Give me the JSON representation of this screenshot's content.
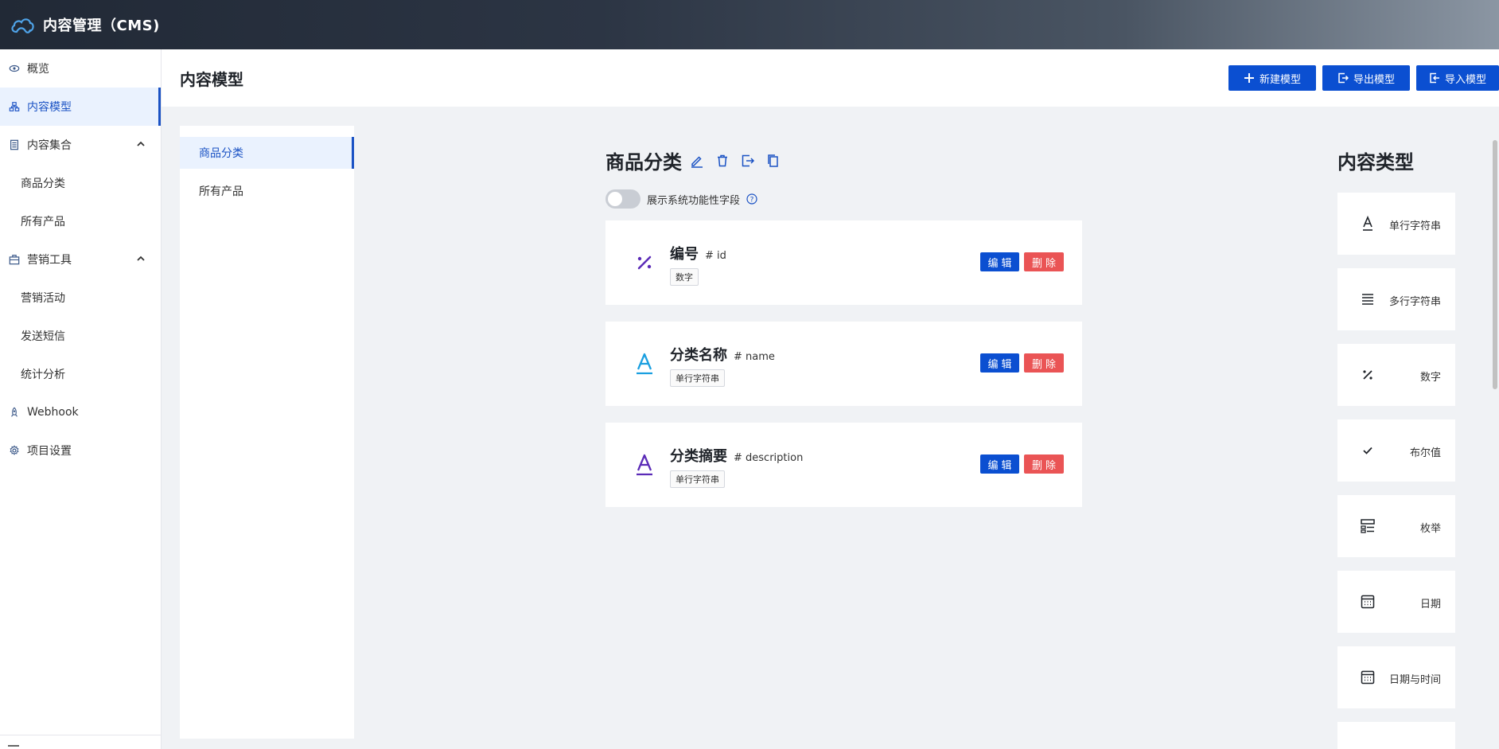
{
  "header": {
    "title": "内容管理（CMS)"
  },
  "sidebar": {
    "items": [
      {
        "label": "概览",
        "icon": "eye-icon"
      },
      {
        "label": "内容模型",
        "icon": "model-icon",
        "active": true
      },
      {
        "label": "内容集合",
        "icon": "collection-icon",
        "expanded": true,
        "children": [
          {
            "label": "商品分类"
          },
          {
            "label": "所有产品"
          }
        ]
      },
      {
        "label": "营销工具",
        "icon": "briefcase-icon",
        "expanded": true,
        "children": [
          {
            "label": "营销活动"
          },
          {
            "label": "发送短信"
          },
          {
            "label": "统计分析"
          }
        ]
      },
      {
        "label": "Webhook",
        "icon": "rocket-icon"
      },
      {
        "label": "项目设置",
        "icon": "gear-icon"
      }
    ]
  },
  "page": {
    "title": "内容模型",
    "buttons": {
      "new_model": "新建模型",
      "export_model": "导出模型",
      "import_model": "导入模型"
    }
  },
  "model_list": [
    {
      "label": "商品分类",
      "active": true
    },
    {
      "label": "所有产品"
    }
  ],
  "model": {
    "name": "商品分类",
    "toggle_label": "展示系统功能性字段",
    "toggle_on": false,
    "fields": [
      {
        "name": "编号",
        "key": "# id",
        "type": "数字",
        "icon": "percent-icon",
        "icon_color": "#5b2bb7"
      },
      {
        "name": "分类名称",
        "key": "# name",
        "type": "单行字符串",
        "icon": "text-a-icon",
        "icon_color": "#1a9fe0"
      },
      {
        "name": "分类摘要",
        "key": "# description",
        "type": "单行字符串",
        "icon": "text-a-icon",
        "icon_color": "#5b2bb7"
      }
    ],
    "edit_label": "编辑",
    "delete_label": "删除"
  },
  "content_types": {
    "title": "内容类型",
    "items": [
      {
        "label": "单行字符串",
        "icon": "text-a-icon"
      },
      {
        "label": "多行字符串",
        "icon": "lines-icon"
      },
      {
        "label": "数字",
        "icon": "percent-icon"
      },
      {
        "label": "布尔值",
        "icon": "check-icon"
      },
      {
        "label": "枚举",
        "icon": "enum-icon"
      },
      {
        "label": "日期",
        "icon": "calendar-icon"
      },
      {
        "label": "日期与时间",
        "icon": "calendar-time-icon"
      }
    ]
  },
  "colors": {
    "primary": "#0b4fd1",
    "danger": "#ea5455",
    "active_bg": "#eaf2fe"
  }
}
